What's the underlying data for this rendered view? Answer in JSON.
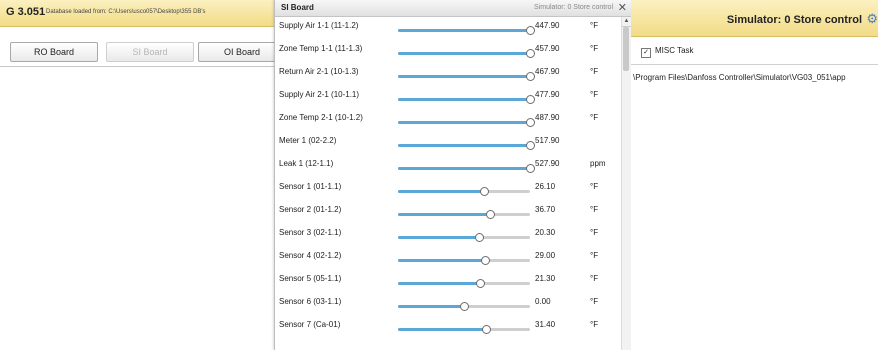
{
  "left_window": {
    "title": "G 3.051",
    "db_message": "Database loaded from: C:\\Users\\usco057\\Desktop\\355 DB's",
    "buttons": [
      {
        "label": "RO Board",
        "enabled": true
      },
      {
        "label": "SI Board",
        "enabled": false
      },
      {
        "label": "OI Board",
        "enabled": true
      }
    ]
  },
  "dialog": {
    "title": "SI Board",
    "subtitle": "Simulator: 0 Store control",
    "close_glyph": "✕",
    "scroll_up_glyph": "▲",
    "rows": [
      {
        "label": "Supply Air 1-1 (11-1.2)",
        "value": "447.90",
        "unit": "°F",
        "fraction": 1.0
      },
      {
        "label": "Zone Temp 1-1 (11-1.3)",
        "value": "457.90",
        "unit": "°F",
        "fraction": 1.0
      },
      {
        "label": "Return Air 2-1 (10-1.3)",
        "value": "467.90",
        "unit": "°F",
        "fraction": 1.0
      },
      {
        "label": "Supply Air 2-1 (10-1.1)",
        "value": "477.90",
        "unit": "°F",
        "fraction": 1.0
      },
      {
        "label": "Zone Temp 2-1 (10-1.2)",
        "value": "487.90",
        "unit": "°F",
        "fraction": 1.0
      },
      {
        "label": "Meter 1 (02-2.2)",
        "value": "517.90",
        "unit": "",
        "fraction": 1.0
      },
      {
        "label": "Leak 1 (12-1.1)",
        "value": "527.90",
        "unit": "ppm",
        "fraction": 1.0
      },
      {
        "label": "Sensor 1 (01-1.1)",
        "value": "26.10",
        "unit": "°F",
        "fraction": 0.65
      },
      {
        "label": "Sensor 2 (01-1.2)",
        "value": "36.70",
        "unit": "°F",
        "fraction": 0.7
      },
      {
        "label": "Sensor 3 (02-1.1)",
        "value": "20.30",
        "unit": "°F",
        "fraction": 0.61
      },
      {
        "label": "Sensor 4 (02-1.2)",
        "value": "29.00",
        "unit": "°F",
        "fraction": 0.66
      },
      {
        "label": "Sensor 5 (05-1.1)",
        "value": "21.30",
        "unit": "°F",
        "fraction": 0.62
      },
      {
        "label": "Sensor 6 (03-1.1)",
        "value": "0.00",
        "unit": "°F",
        "fraction": 0.5
      },
      {
        "label": "Sensor 7 (Ca-01)",
        "value": "31.40",
        "unit": "°F",
        "fraction": 0.67
      }
    ]
  },
  "right_window": {
    "title": "Simulator: 0 Store control",
    "gear_glyph": "⚙",
    "misc_task_label": "MISC Task",
    "misc_task_checked": true,
    "path": "\\Program Files\\Danfoss Controller\\Simulator\\VG03_051\\app"
  },
  "colors": {
    "title_bar": "#f2dc86",
    "slider_fill": "#5aa7d8",
    "slider_track": "#cfcfcf"
  }
}
